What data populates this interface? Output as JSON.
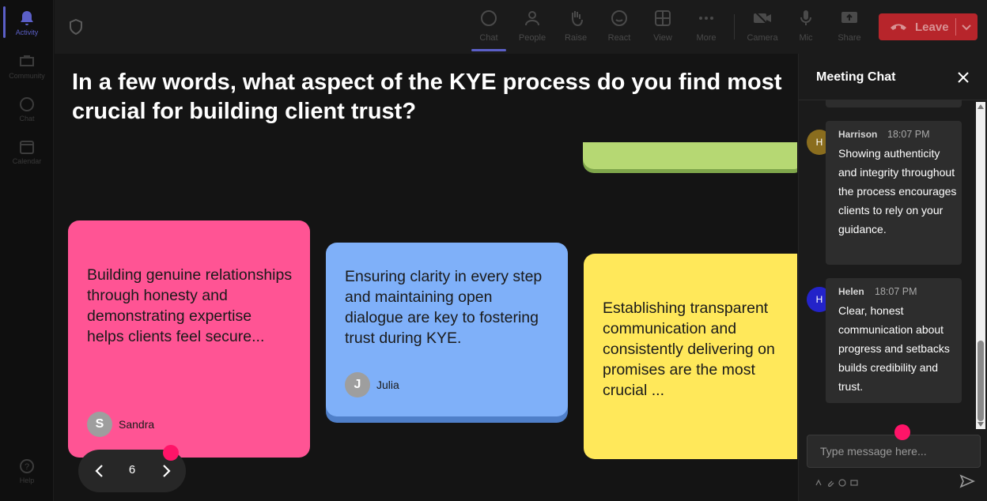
{
  "rail": {
    "items": [
      {
        "label": "Activity",
        "icon": "bell-icon",
        "active": true
      },
      {
        "label": "Community",
        "icon": "community-icon"
      },
      {
        "label": "Chat",
        "icon": "chat-icon"
      },
      {
        "label": "Calendar",
        "icon": "calendar-icon"
      }
    ],
    "help_label": "Help"
  },
  "toolbar": {
    "chat": "Chat",
    "people": "People",
    "raise": "Raise",
    "react": "React",
    "view": "View",
    "more": "More",
    "camera": "Camera",
    "mic": "Mic",
    "share": "Share",
    "leave": "Leave"
  },
  "stage": {
    "question": "In a few words, what aspect of the KYE process do you find most crucial for building client trust?",
    "cards": [
      {
        "text": "Building genuine relationships through honesty and demonstrating expertise helps clients feel secure...",
        "author": "Sandra",
        "initial": "S",
        "color": "#ff5494"
      },
      {
        "text": "Ensuring clarity in every step and maintaining open dialogue are key to fostering trust during KYE.",
        "author": "Julia",
        "initial": "J",
        "color": "#7fb0f9"
      },
      {
        "text": "Establishing transparent communication and consistently delivering on promises are the most crucial ...",
        "color": "#ffe85a"
      }
    ],
    "pager": {
      "page": "6"
    }
  },
  "chat": {
    "title": "Meeting Chat",
    "messages": [
      {
        "sender": "Harrison",
        "initial": "H",
        "time": "18:07 PM",
        "text": "Showing authenticity and integrity throughout the process encourages clients to rely on your guidance.",
        "avatar_color": "#8a6d1e"
      },
      {
        "sender": "Helen",
        "initial": "H",
        "time": "18:07 PM",
        "text": "Clear, honest communication about progress and setbacks builds credibility and trust.",
        "avatar_color": "#2323c9"
      }
    ],
    "input_placeholder": "Type message here..."
  },
  "colors": {
    "accent": "#5b5fc7",
    "leave": "#b7252b",
    "marker": "#ff1468"
  }
}
